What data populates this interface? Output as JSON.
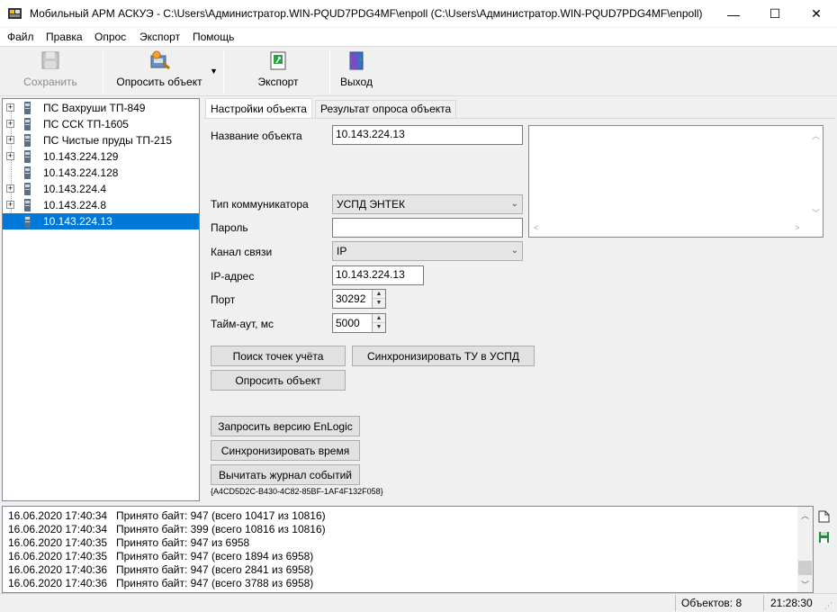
{
  "window": {
    "title": "Мобильный АРМ АСКУЭ - C:\\Users\\Администратор.WIN-PQUD7PDG4MF\\enpoll (C:\\Users\\Администратор.WIN-PQUD7PDG4MF\\enpoll)",
    "minimize": "—",
    "maximize": "☐",
    "close": "✕"
  },
  "menu": [
    "Файл",
    "Правка",
    "Опрос",
    "Экспорт",
    "Помощь"
  ],
  "toolbar": {
    "save": "Сохранить",
    "poll": "Опросить объект",
    "export": "Экспорт",
    "exit": "Выход"
  },
  "tree": [
    {
      "label": "ПС Вахруши ТП-849",
      "expandable": true,
      "selected": false
    },
    {
      "label": "ПС ССК ТП-1605",
      "expandable": true,
      "selected": false
    },
    {
      "label": "ПС Чистые пруды ТП-215",
      "expandable": true,
      "selected": false
    },
    {
      "label": "10.143.224.129",
      "expandable": true,
      "selected": false
    },
    {
      "label": "10.143.224.128",
      "expandable": false,
      "selected": false
    },
    {
      "label": "10.143.224.4",
      "expandable": true,
      "selected": false
    },
    {
      "label": "10.143.224.8",
      "expandable": true,
      "selected": false
    },
    {
      "label": "10.143.224.13",
      "expandable": false,
      "selected": true
    }
  ],
  "tabs": [
    "Настройки объекта",
    "Результат опроса объекта"
  ],
  "form": {
    "name_label": "Название объекта",
    "name_value": "10.143.224.13",
    "comm_type_label": "Тип коммуникатора",
    "comm_type_value": "УСПД ЭНТЕК",
    "password_label": "Пароль",
    "password_value": "",
    "channel_label": "Канал связи",
    "channel_value": "IP",
    "ip_label": "IP-адрес",
    "ip_value": "10.143.224.13",
    "port_label": "Порт",
    "port_value": "30292",
    "timeout_label": "Тайм-аут, мс",
    "timeout_value": "5000"
  },
  "buttons": {
    "find_points": "Поиск точек учёта",
    "sync_tu": "Синхронизировать ТУ в УСПД",
    "poll_object": "Опросить объект",
    "request_version": "Запросить версию EnLogic",
    "sync_time": "Синхронизировать время",
    "read_log": "Вычитать журнал событий"
  },
  "guid": "{A4CD5D2C-B430-4C82-85BF-1AF4F132F058}",
  "log": [
    {
      "ts": "16.06.2020 17:40:34",
      "msg": "Принято байт: 947 (всего 10417 из 10816)"
    },
    {
      "ts": "16.06.2020 17:40:34",
      "msg": "Принято байт: 399 (всего 10816 из 10816)"
    },
    {
      "ts": "16.06.2020 17:40:35",
      "msg": "Принято байт: 947 из 6958"
    },
    {
      "ts": "16.06.2020 17:40:35",
      "msg": "Принято байт: 947 (всего 1894 из 6958)"
    },
    {
      "ts": "16.06.2020 17:40:36",
      "msg": "Принято байт: 947 (всего 2841 из 6958)"
    },
    {
      "ts": "16.06.2020 17:40:36",
      "msg": "Принято байт: 947 (всего 3788 из 6958)"
    }
  ],
  "status": {
    "objects": "Объектов: 8",
    "time": "21:28:30"
  },
  "colors": {
    "selection": "#0078d7",
    "window_bg": "#f0f0f0",
    "save_icon_green": "#1e8c3a"
  }
}
